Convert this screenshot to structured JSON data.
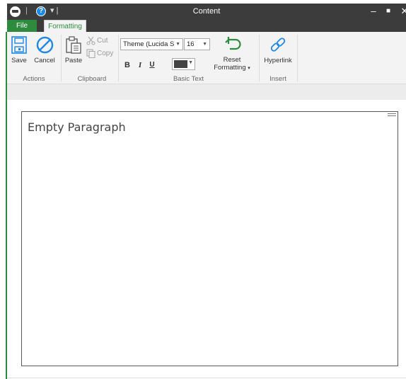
{
  "window": {
    "title": "Content",
    "minimize_glyph": "–",
    "maximize_glyph": "■",
    "close_glyph": "✕",
    "quick_access_sep": "|",
    "help_glyph": "?",
    "qa_glyph": "⩡"
  },
  "tabs": [
    {
      "label": "File"
    },
    {
      "label": "Formatting"
    }
  ],
  "ribbon": {
    "actions": {
      "group_label": "Actions",
      "save_label": "Save",
      "cancel_label": "Cancel"
    },
    "clipboard": {
      "group_label": "Clipboard",
      "paste_label": "Paste",
      "cut_label": "Cut",
      "copy_label": "Copy"
    },
    "basic_text": {
      "group_label": "Basic Text",
      "font_value": "Theme (Lucida S",
      "size_value": "16",
      "bold_label": "B",
      "italic_label": "I",
      "underline_label": "U",
      "font_color": "#444444",
      "reset_label_line1": "Reset",
      "reset_label_line2": "Formatting"
    },
    "insert": {
      "group_label": "Insert",
      "hyperlink_label": "Hyperlink"
    }
  },
  "editor": {
    "paragraph_text": "Empty Paragraph"
  },
  "colors": {
    "accent_green": "#2e8b3e",
    "icon_blue": "#1e88e5",
    "titlebar_bg": "#3c3c3c",
    "ribbon_bg": "#f3f3f3"
  }
}
